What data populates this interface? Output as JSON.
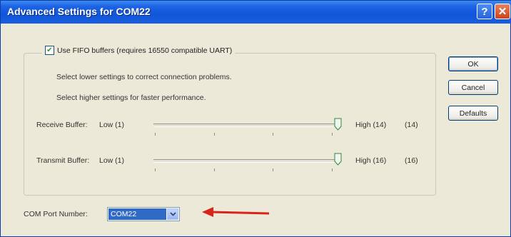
{
  "window": {
    "title": "Advanced Settings for COM22",
    "help_glyph": "?",
    "close_glyph": "✕"
  },
  "fifo": {
    "checkbox_label": "Use FIFO buffers (requires 16550 compatible UART)",
    "checked": true,
    "hint_lower": "Select lower settings to correct connection problems.",
    "hint_higher": "Select higher settings for faster performance."
  },
  "receive_buffer": {
    "label": "Receive Buffer:",
    "low_label": "Low (1)",
    "high_label": "High (14)",
    "current_value": "(14)",
    "min": 1,
    "max": 14,
    "value": 14
  },
  "transmit_buffer": {
    "label": "Transmit Buffer:",
    "low_label": "Low (1)",
    "high_label": "High (16)",
    "current_value": "(16)",
    "min": 1,
    "max": 16,
    "value": 16
  },
  "com_port": {
    "label": "COM Port Number:",
    "selected": "COM22"
  },
  "buttons": {
    "ok": "OK",
    "cancel": "Cancel",
    "defaults": "Defaults"
  },
  "colors": {
    "titlebar": "#1155d8",
    "annotation_arrow": "#d9241c",
    "selection": "#316ac5"
  }
}
